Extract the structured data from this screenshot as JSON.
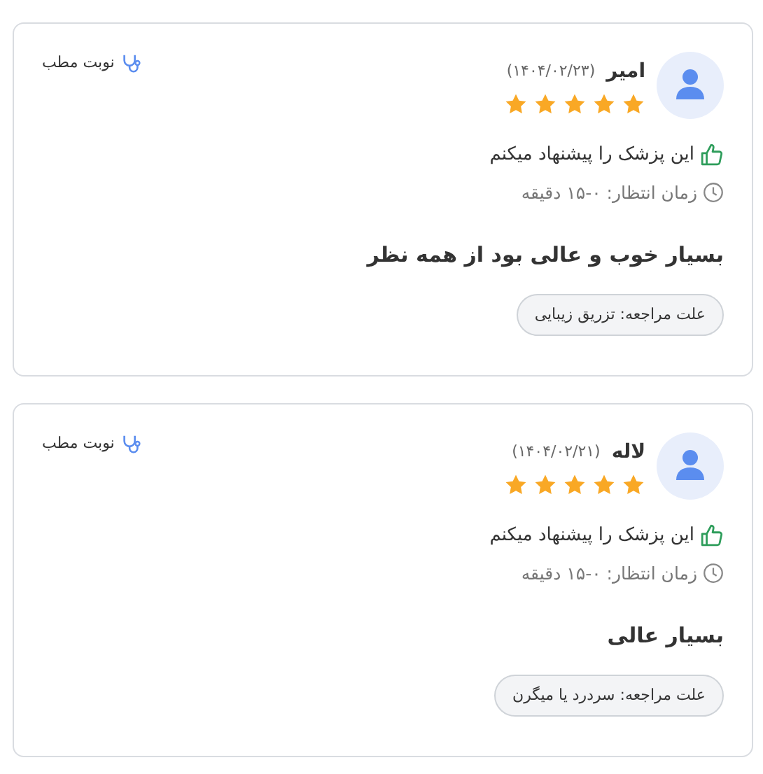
{
  "reviews": [
    {
      "name": "امیر",
      "date": "(۱۴۰۴/۰۲/۲۳)",
      "stars": 5,
      "visit_type": "نوبت مطب",
      "recommended": true,
      "recommend_text": "این پزشک را پیشنهاد میکنم",
      "wait_time": "زمان انتظار: ۰-۱۵ دقیقه",
      "comment": "بسیار خوب و عالی بود از همه نظر",
      "reason": "علت مراجعه: تزریق زیبایی"
    },
    {
      "name": "لاله",
      "date": "(۱۴۰۴/۰۲/۲۱)",
      "stars": 5,
      "visit_type": "نوبت مطب",
      "recommended": true,
      "recommend_text": "این پزشک را پیشنهاد میکنم",
      "wait_time": "زمان انتظار: ۰-۱۵ دقیقه",
      "comment": "بسیار عالی",
      "reason": "علت مراجعه: سردرد یا میگرن"
    }
  ]
}
